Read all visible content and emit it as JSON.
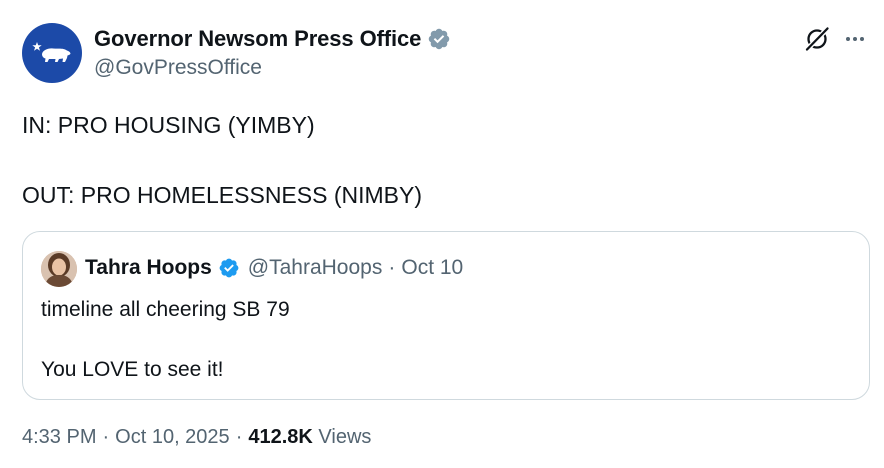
{
  "author": {
    "display_name": "Governor Newsom Press Office",
    "handle": "@GovPressOffice",
    "avatar_icon": "california-bear-logo-icon",
    "avatar_color": "#1c4aa8",
    "verified_icon": "verified-badge-icon",
    "verified_color": "#829aab"
  },
  "header_actions": {
    "grok_icon": "grok-icon",
    "more_icon": "more-options-icon"
  },
  "tweet": {
    "line1": "IN: PRO HOUSING (YIMBY)",
    "line2": "OUT: PRO HOMELESSNESS (NIMBY)"
  },
  "quoted_tweet": {
    "display_name": "Tahra Hoops",
    "handle": "@TahraHoops",
    "separator": "·",
    "date": "Oct 10",
    "verified_icon": "verified-badge-icon",
    "verified_color": "#1d9bf0",
    "line1": "timeline all cheering SB 79",
    "line2": "You LOVE to see it!"
  },
  "meta": {
    "time": "4:33 PM",
    "sep1": "·",
    "date": "Oct 10, 2025",
    "sep2": "·",
    "views_count": "412.8K",
    "views_label": "Views"
  },
  "colors": {
    "text_primary": "#0f1419",
    "text_secondary": "#536471",
    "border": "#cfd9de"
  }
}
